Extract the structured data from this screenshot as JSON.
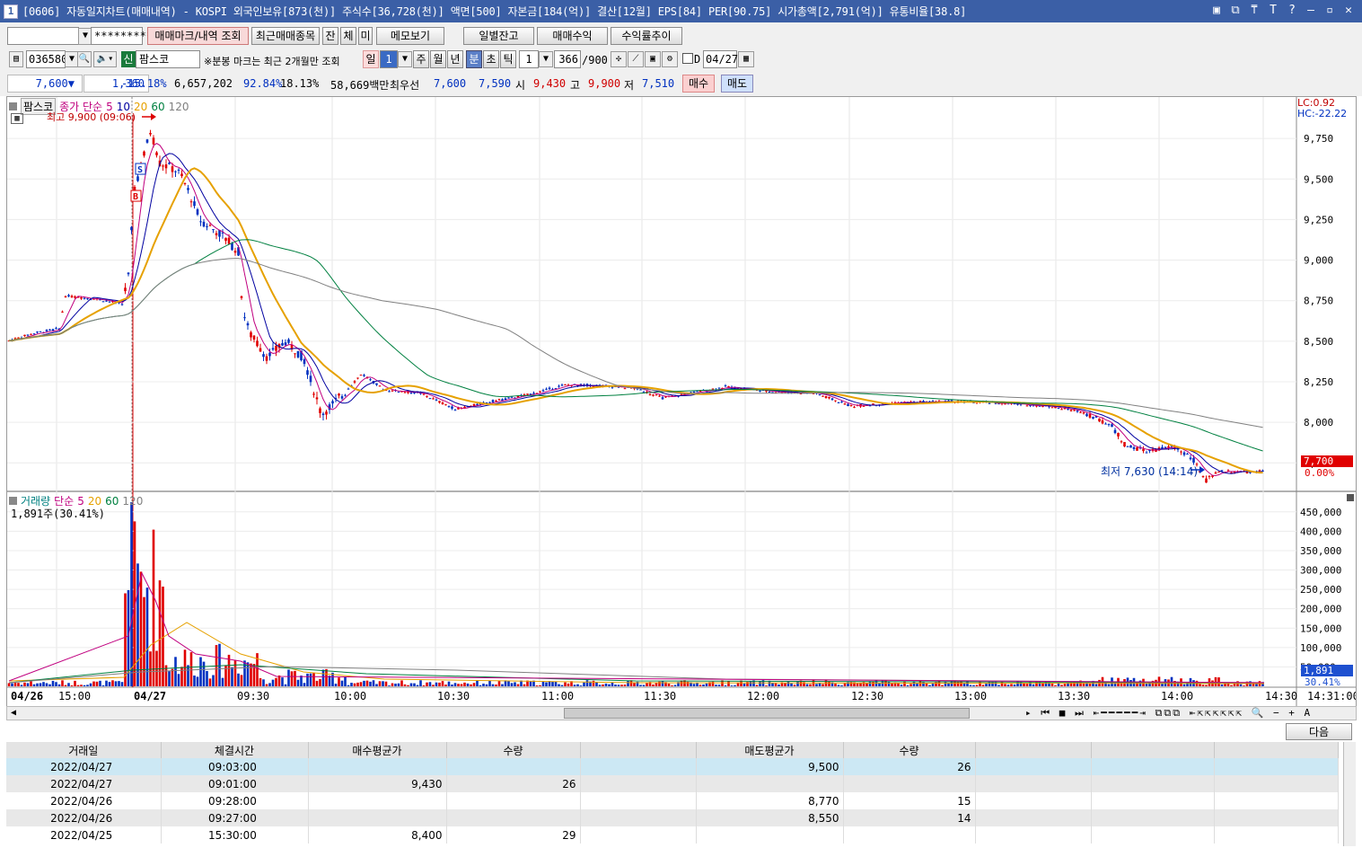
{
  "window": {
    "number": "1",
    "title": "[0606] 자동일지차트(매매내역) - KOSPI 외국인보유[873(천)] 주식수[36,728(천)] 액면[500] 자본금[184(억)] 결산[12월] EPS[84] PER[90.75] 시가총액[2,791(억)] 유통비율[38.8]",
    "controls": [
      "▣",
      "⧉",
      "⍑",
      "T",
      "?",
      "—",
      "▫",
      "✕"
    ]
  },
  "toolbar1": {
    "account_value": "",
    "password_value": "*********",
    "buttons": [
      "매매마크/내역 조회",
      "최근매매종목",
      "잔",
      "체",
      "미",
      "메모보기",
      "일별잔고",
      "매매수익",
      "수익률추이"
    ]
  },
  "toolbar2": {
    "code": "036580",
    "name_badge": "신",
    "name": "팜스코",
    "notice": "※분봉 마크는 최근 2개월만 조회",
    "period_buttons": [
      "일",
      "주",
      "월",
      "년",
      "분",
      "초",
      "틱"
    ],
    "day_count": "1",
    "minute_value": "1",
    "range_value": "366",
    "range_max": "/900",
    "date_check_label": "D",
    "date_value": "04/27"
  },
  "pricebar": {
    "price": "7,600",
    "change_arrow": "▼",
    "change": "1,360",
    "change_pct": "-15.18%",
    "volume": "6,657,202",
    "vol_ratio": "92.84%",
    "turnover": "18.13%",
    "amount": "58,669백만",
    "best_label": "최우선",
    "best_ask": "7,600",
    "best_bid": "7,590",
    "open_label": "시",
    "open": "9,430",
    "high_label": "고",
    "high": "9,900",
    "low_label": "저",
    "low": "7,510",
    "buy_label": "매수",
    "sell_label": "매도"
  },
  "chart": {
    "legend_name": "팜스코",
    "legend_ma_label": "종가 단순",
    "ma_periods": [
      "5",
      "10",
      "20",
      "60",
      "120"
    ],
    "ma_colors": [
      "#c0007f",
      "#0000a0",
      "#e6a100",
      "#008040",
      "#808080"
    ],
    "high_label": "최고 9,900 (09:06)",
    "low_label": "최저 7,630 (14:14)",
    "lc_label": "LC:0.92",
    "hc_label": "HC:-22.22",
    "current_price_tag": "7,700",
    "current_pct_tag": "0.00%",
    "price_ticks": [
      "9,750",
      "9,500",
      "9,250",
      "9,000",
      "8,750",
      "8,500",
      "8,250",
      "8,000",
      "7,750"
    ],
    "volume_legend_name": "거래량",
    "volume_legend_ma": "단순",
    "volume_value": "1,891주(30.41%)",
    "volume_ticks": [
      "450,000",
      "400,000",
      "350,000",
      "300,000",
      "250,000",
      "200,000",
      "150,000",
      "100,000",
      "50,000"
    ],
    "volume_tag": "1,891",
    "volume_tag_pct": "30.41%",
    "time_labels": [
      "04/26",
      "15:00",
      "04/27",
      "09:30",
      "10:00",
      "10:30",
      "11:00",
      "11:30",
      "12:00",
      "12:30",
      "13:00",
      "13:30",
      "14:00",
      "14:30",
      "14:31:00"
    ],
    "buy_marker": "B",
    "sell_marker": "S"
  },
  "chart_data": {
    "type": "candlestick",
    "price_axis": [
      7600,
      9900
    ],
    "volume_axis": [
      0,
      475000
    ]
  },
  "table": {
    "headers": [
      "거래일",
      "체결시간",
      "매수평균가",
      "수량",
      "",
      "매도평균가",
      "수량",
      "",
      "",
      ""
    ],
    "rows": [
      [
        "2022/04/27",
        "09:03:00",
        "",
        "",
        "",
        "9,500",
        "26",
        "",
        "",
        ""
      ],
      [
        "2022/04/27",
        "09:01:00",
        "9,430",
        "26",
        "",
        "",
        "",
        "",
        "",
        ""
      ],
      [
        "2022/04/26",
        "09:28:00",
        "",
        "",
        "",
        "8,770",
        "15",
        "",
        "",
        ""
      ],
      [
        "2022/04/26",
        "09:27:00",
        "",
        "",
        "",
        "8,550",
        "14",
        "",
        "",
        ""
      ],
      [
        "2022/04/25",
        "15:30:00",
        "8,400",
        "29",
        "",
        "",
        "",
        "",
        "",
        ""
      ]
    ],
    "next_label": "다음"
  }
}
